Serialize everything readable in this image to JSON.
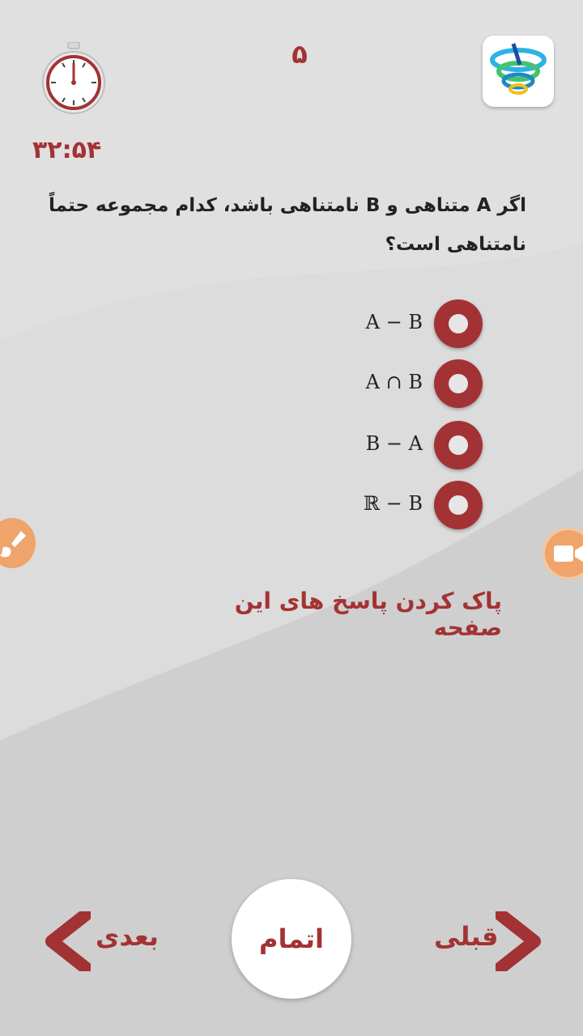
{
  "header": {
    "question_number": "۵",
    "timer_text": "۳۲:۵۴"
  },
  "question": {
    "line1": "اگر A متناهی و B نامتناهی باشد، کدام مجموعه حتماً",
    "line2": "نامتناهی است؟"
  },
  "options": [
    {
      "label": "A − B"
    },
    {
      "label": "A ∩ B"
    },
    {
      "label": "B − A"
    },
    {
      "label": "ℝ − B"
    }
  ],
  "actions": {
    "clear_answers": "پاک کردن پاسخ های این صفحه"
  },
  "footer": {
    "prev_label": "قبلی",
    "finish_label": "اتمام",
    "next_label": "بعدی"
  },
  "colors": {
    "accent": "#a33234",
    "side_button": "#eea46a",
    "background": "#cfcfcf"
  },
  "icons": {
    "timer": "stopwatch-icon",
    "logo": "app-logo-icon",
    "left_side": "brush-icon",
    "right_side": "video-camera-icon",
    "prev": "chevron-right-icon",
    "next": "chevron-left-icon"
  }
}
